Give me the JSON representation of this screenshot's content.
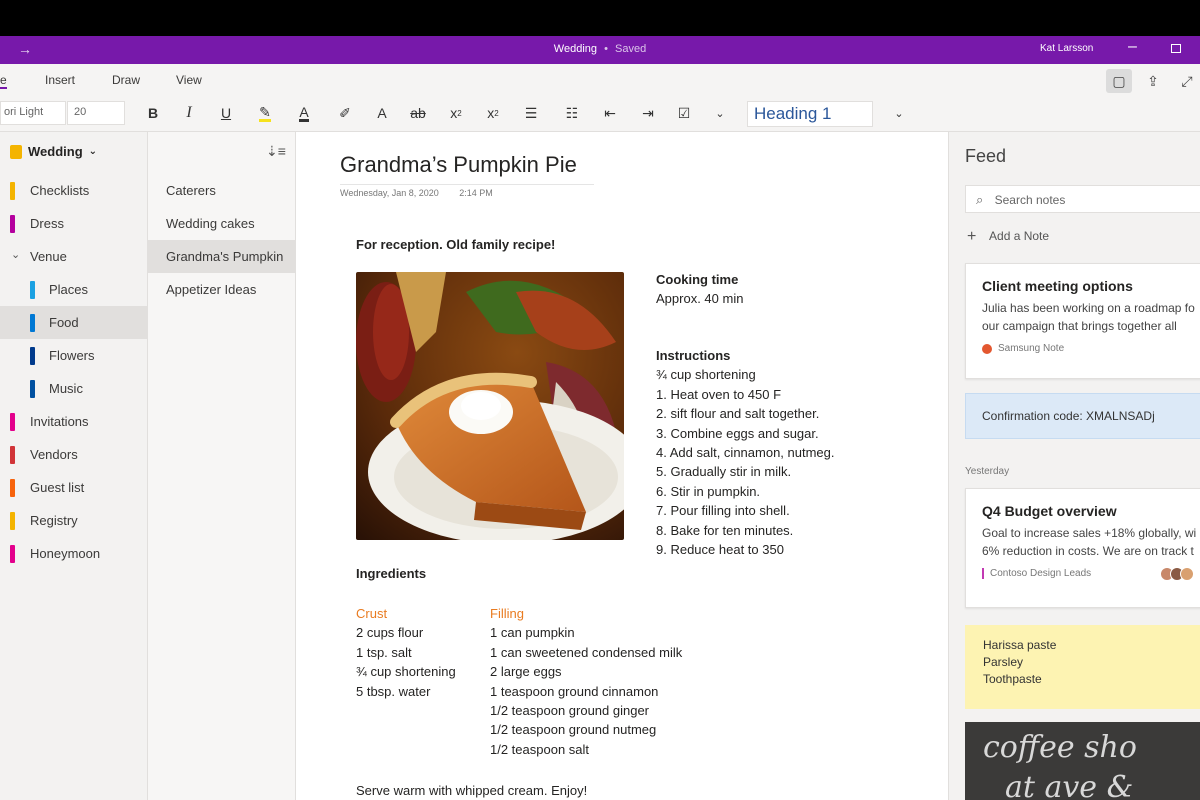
{
  "titlebar": {
    "document": "Wedding",
    "separator": "•",
    "status": "Saved",
    "user": "Kat Larsson"
  },
  "ribbon": {
    "tabs": [
      "e",
      "Insert",
      "Draw",
      "View"
    ],
    "font_name": "ori Light",
    "font_size": "20",
    "style": "Heading 1"
  },
  "notebook": {
    "name": "Wedding",
    "sections": [
      {
        "label": "Checklists",
        "color": "#f4b400"
      },
      {
        "label": "Dress",
        "color": "#b4009e"
      },
      {
        "label": "Venue",
        "color": ""
      },
      {
        "label": "Places",
        "color": "#1ba1e2"
      },
      {
        "label": "Food",
        "color": "#0078d4"
      },
      {
        "label": "Flowers",
        "color": "#003a8c"
      },
      {
        "label": "Music",
        "color": "#0050a0"
      },
      {
        "label": "Invitations",
        "color": "#e3008c"
      },
      {
        "label": "Vendors",
        "color": "#d13438"
      },
      {
        "label": "Guest list",
        "color": "#f7630c"
      },
      {
        "label": "Registry",
        "color": "#f4b400"
      },
      {
        "label": "Honeymoon",
        "color": "#e3008c"
      }
    ]
  },
  "pages": [
    "Caterers",
    "Wedding cakes",
    "Grandma's Pumpkin",
    "Appetizer Ideas"
  ],
  "note": {
    "title": "Grandma’s Pumpkin Pie",
    "date": "Wednesday, Jan 8, 2020",
    "time": "2:14 PM",
    "intro": "For reception. Old family recipe!",
    "cooking_heading": "Cooking time",
    "cooking_value": "Approx. 40 min",
    "instructions_heading": "Instructions",
    "instructions": [
      "¾ cup shortening",
      "1. Heat oven to 450 F",
      "2. sift flour and salt together.",
      "3. Combine eggs and sugar.",
      "4. Add salt, cinnamon, nutmeg.",
      "5. Gradually stir in milk.",
      "6. Stir in pumpkin.",
      "7. Pour filling into shell.",
      "8. Bake for ten minutes.",
      "9. Reduce heat to 350"
    ],
    "ingredients_heading": "Ingredients",
    "crust_heading": "Crust",
    "crust": [
      "2 cups flour",
      "1 tsp. salt",
      "¾ cup shortening",
      "5 tbsp. water"
    ],
    "filling_heading": "Filling",
    "filling": [
      "1 can pumpkin",
      "1 can sweetened condensed milk",
      "2 large eggs",
      "1 teaspoon ground cinnamon",
      "1/2 teaspoon ground ginger",
      "1/2 teaspoon ground nutmeg",
      "1/2 teaspoon salt"
    ],
    "closing": "Serve warm with whipped cream. Enjoy!"
  },
  "feed": {
    "title": "Feed",
    "search_placeholder": "Search notes",
    "add_note": "Add a Note",
    "card1": {
      "title": "Client meeting options",
      "body1": "Julia has been working on a roadmap fo",
      "body2": "our campaign that brings together all",
      "source": "Samsung Note"
    },
    "confirmation": "Confirmation code: XMALNSADj",
    "yesterday": "Yesterday",
    "card2": {
      "title": "Q4 Budget overview",
      "body1": "Goal to increase sales +18% globally, wi",
      "body2": "6% reduction in costs. We are on track t",
      "source": "Contoso Design Leads"
    },
    "sticky": [
      "Harissa paste",
      "Parsley",
      "Toothpaste"
    ],
    "handwriting1": "coffee sho",
    "handwriting2": "at ave &"
  }
}
